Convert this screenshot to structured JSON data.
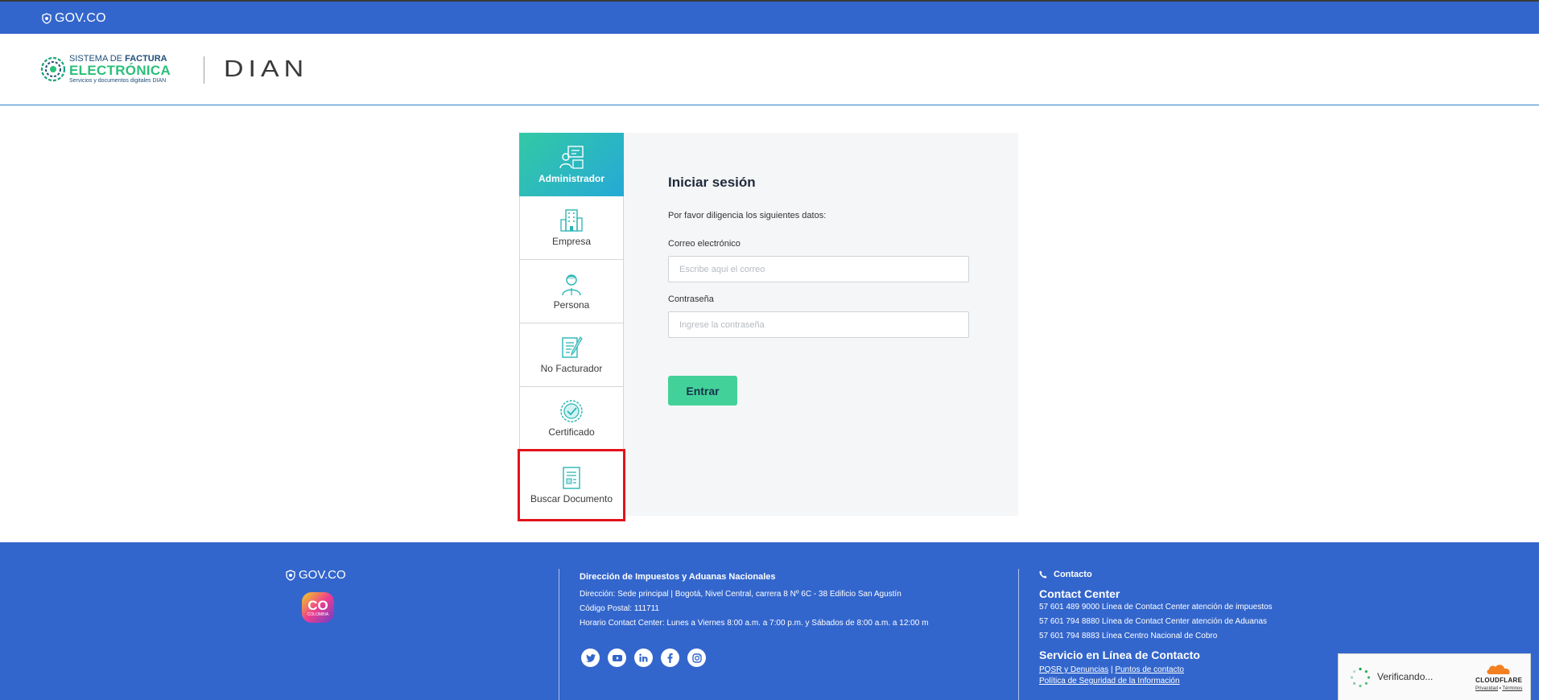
{
  "topbar": {
    "gov_label": "GOV.CO"
  },
  "header": {
    "logo_line1_prefix": "SISTEMA DE ",
    "logo_line1_bold": "FACTURA",
    "logo_line2": "ELECTRÓNICA",
    "logo_line3": "Servicios y documentos digitales DIAN",
    "dian_logo": "DIAN"
  },
  "tabs": [
    {
      "label": "Administrador",
      "icon": "admin-icon",
      "active": true
    },
    {
      "label": "Empresa",
      "icon": "building-icon"
    },
    {
      "label": "Persona",
      "icon": "person-icon"
    },
    {
      "label": "No Facturador",
      "icon": "document-pen-icon"
    },
    {
      "label": "Certificado",
      "icon": "certificate-icon"
    },
    {
      "label": "Buscar Documento",
      "icon": "document-search-icon",
      "highlighted": true
    }
  ],
  "login": {
    "title": "Iniciar sesión",
    "subtitle": "Por favor diligencia los siguientes datos:",
    "email_label": "Correo electrónico",
    "email_placeholder": "Escribe aqui el correo",
    "password_label": "Contraseña",
    "password_placeholder": "Ingrese la contraseña",
    "submit_label": "Entrar"
  },
  "footer": {
    "gov_label": "GOV.CO",
    "co_logo_text": "CO",
    "co_logo_sub": "COLOMBIA",
    "org_title": "Dirección de Impuestos y Aduanas Nacionales",
    "address": "Dirección: Sede principal | Bogotá, Nivel Central, carrera 8 Nº 6C - 38 Edificio San Agustín",
    "postal": "Código Postal: 111711",
    "hours": "Horario Contact Center: Lunes a Viernes 8:00 a.m. a 7:00 p.m. y Sábados de 8:00 a.m. a 12:00 m",
    "social": [
      "twitter-icon",
      "youtube-icon",
      "linkedin-icon",
      "facebook-icon",
      "instagram-icon"
    ],
    "contact_heading": "Contacto",
    "contact_center_title": "Contact Center",
    "phones": [
      "57 601 489 9000 Línea de Contact Center atención de impuestos",
      "57 601 794 8880 Línea de Contact Center atención de Aduanas",
      "57 601 794 8883 Línea Centro Nacional de Cobro"
    ],
    "online_title": "Servicio en Línea de Contacto",
    "link_posr": "PQSR y Denuncias",
    "link_sep": "|",
    "link_puntos": "Puntos de contacto",
    "link_politica": "Política de Seguridad de la Información"
  },
  "cloudflare": {
    "status": "Verificando...",
    "brand": "CLOUDFLARE",
    "privacy": "Privacidad",
    "dot": "•",
    "terms": "Términos"
  },
  "colors": {
    "gov_blue": "#3366cc",
    "accent_green": "#43d19a",
    "tab_gradient_start": "#33c9a5",
    "tab_gradient_end": "#25a9d6",
    "highlight_red": "#e3131b"
  }
}
